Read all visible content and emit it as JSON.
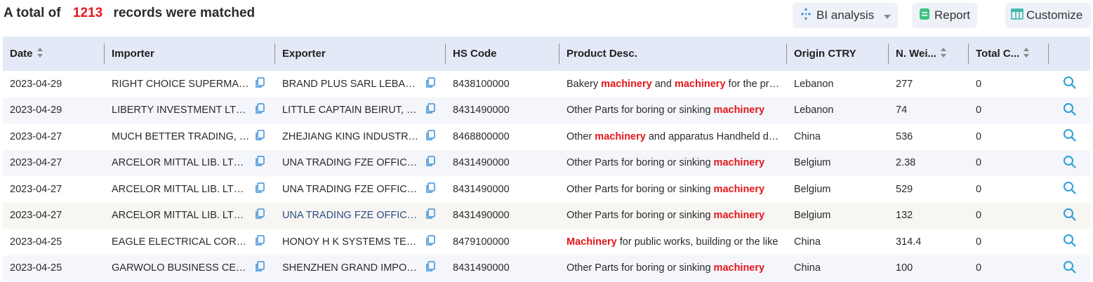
{
  "summary": {
    "prefix": "A total of",
    "count": "1213",
    "suffix": "records were matched"
  },
  "toolbar": {
    "bi_label": "BI analysis",
    "report_label": "Report",
    "customize_label": "Customize"
  },
  "columns": [
    "Date",
    "Importer",
    "Exporter",
    "HS Code",
    "Product Desc.",
    "Origin CTRY",
    "N. Wei...",
    "Total C...",
    ""
  ],
  "rows": [
    {
      "date": "2023-04-29",
      "importer": "RIGHT CHOICE SUPERMARKET",
      "exporter": "BRAND PLUS SARL LEBANON",
      "hs": "8438100000",
      "desc": [
        [
          "Bakery ",
          false
        ],
        [
          "machinery",
          true
        ],
        [
          " and ",
          false
        ],
        [
          "machinery",
          true
        ],
        [
          " for the preparation of food",
          false
        ]
      ],
      "origin": "Lebanon",
      "weight": "277",
      "total": "0"
    },
    {
      "date": "2023-04-29",
      "importer": "LIBERTY INVESTMENT LTD CO",
      "exporter": "LITTLE CAPTAIN BEIRUT, LEBANON",
      "hs": "8431490000",
      "desc": [
        [
          "Other Parts for boring or sinking ",
          false
        ],
        [
          "machinery",
          true
        ]
      ],
      "origin": "Lebanon",
      "weight": "74",
      "total": "0"
    },
    {
      "date": "2023-04-27",
      "importer": "MUCH BETTER TRADING, INC",
      "exporter": "ZHEJIANG KING INDUSTRY CO LTD",
      "hs": "8468800000",
      "desc": [
        [
          "Other ",
          false
        ],
        [
          "machinery",
          true
        ],
        [
          " and apparatus Handheld devices",
          false
        ]
      ],
      "origin": "China",
      "weight": "536",
      "total": "0"
    },
    {
      "date": "2023-04-27",
      "importer": "ARCELOR MITTAL LIB. LTD CO",
      "exporter": "UNA TRADING FZE OFFICE DUBAI",
      "hs": "8431490000",
      "desc": [
        [
          "Other Parts for boring or sinking ",
          false
        ],
        [
          "machinery",
          true
        ]
      ],
      "origin": "Belgium",
      "weight": "2.38",
      "total": "0"
    },
    {
      "date": "2023-04-27",
      "importer": "ARCELOR MITTAL LIB. LTD CO",
      "exporter": "UNA TRADING FZE OFFICE DUBAI",
      "hs": "8431490000",
      "desc": [
        [
          "Other Parts for boring or sinking ",
          false
        ],
        [
          "machinery",
          true
        ]
      ],
      "origin": "Belgium",
      "weight": "529",
      "total": "0"
    },
    {
      "date": "2023-04-27",
      "importer": "ARCELOR MITTAL LIB. LTD CO",
      "exporter": "UNA TRADING FZE OFFICE DUBAI",
      "hs": "8431490000",
      "desc": [
        [
          "Other Parts for boring or sinking ",
          false
        ],
        [
          "machinery",
          true
        ]
      ],
      "origin": "Belgium",
      "weight": "132",
      "total": "0",
      "highlight": true
    },
    {
      "date": "2023-04-25",
      "importer": "EAGLE ELECTRICAL CORPORATION",
      "exporter": "HONOY H K SYSTEMS TECHNOLOGY",
      "hs": "8479100000",
      "desc": [
        [
          "Machinery",
          true
        ],
        [
          " for public works, building or the like",
          false
        ]
      ],
      "origin": "China",
      "weight": "314.4",
      "total": "0"
    },
    {
      "date": "2023-04-25",
      "importer": "GARWOLO BUSINESS CENTER",
      "exporter": "SHENZHEN GRAND IMPORT EXPORT",
      "hs": "8431490000",
      "desc": [
        [
          "Other Parts for boring or sinking ",
          false
        ],
        [
          "machinery",
          true
        ]
      ],
      "origin": "China",
      "weight": "100",
      "total": "0"
    }
  ],
  "colors": {
    "accent": "#e4161a",
    "header_bg": "#e4e9f7",
    "search": "#2a9fd6",
    "copy": "#3a8ed8",
    "report": "#3cc47c"
  },
  "icons": {
    "bi": "diamond-grid-icon",
    "report": "report-doc-icon",
    "customize": "table-layout-icon",
    "copy": "copy-icon",
    "search": "search-icon",
    "sort": "sort-icon"
  }
}
